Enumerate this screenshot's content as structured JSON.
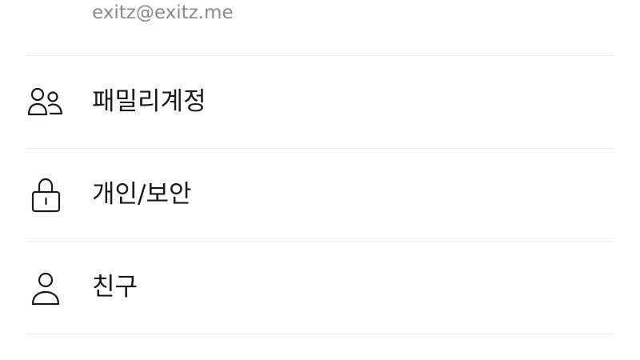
{
  "account": {
    "email": "exitz@exitz.me"
  },
  "menu": {
    "items": [
      {
        "label": "패밀리계정",
        "icon": "family-users-icon"
      },
      {
        "label": "개인/보안",
        "icon": "lock-icon"
      },
      {
        "label": "친구",
        "icon": "person-icon"
      }
    ]
  },
  "colors": {
    "text": "#1a1a1a",
    "secondary_text": "#8a8a8a",
    "divider": "#eeeeee",
    "icon_stroke": "#1a1a1a"
  }
}
